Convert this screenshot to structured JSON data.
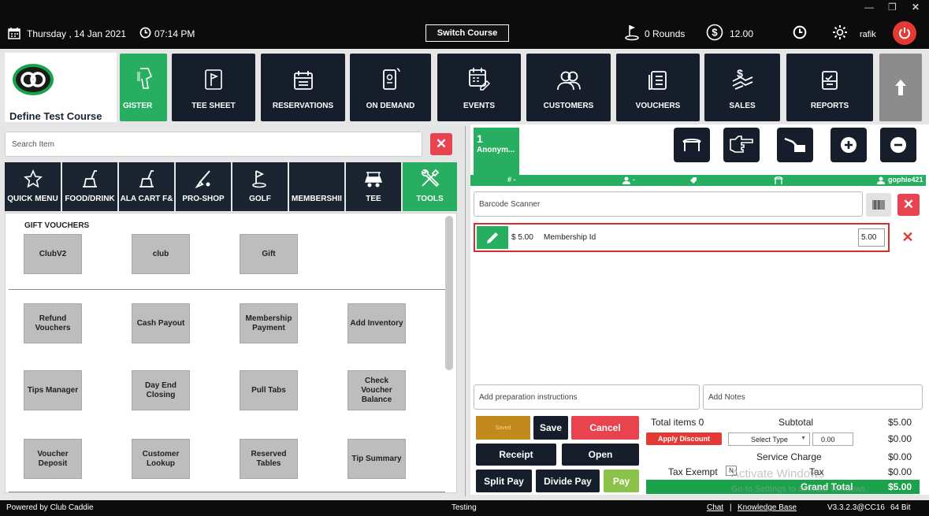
{
  "topbar": {
    "date": "Thursday , 14 Jan 2021",
    "time": "07:14 PM",
    "switch_course": "Switch Course",
    "rounds": "0 Rounds",
    "balance": "12.00",
    "user": "rafik"
  },
  "course": {
    "name": "Define Test Course"
  },
  "nav": [
    {
      "label": "GISTER",
      "icon": "barcode-scanner-icon"
    },
    {
      "label": "TEE SHEET",
      "icon": "flag-icon"
    },
    {
      "label": "RESERVATIONS",
      "icon": "calendar-icon"
    },
    {
      "label": "ON DEMAND",
      "icon": "mobile-icon"
    },
    {
      "label": "EVENTS",
      "icon": "event-calendar-icon"
    },
    {
      "label": "CUSTOMERS",
      "icon": "users-icon"
    },
    {
      "label": "VOUCHERS",
      "icon": "voucher-icon"
    },
    {
      "label": "SALES",
      "icon": "sales-icon"
    },
    {
      "label": "REPORTS",
      "icon": "report-icon"
    }
  ],
  "search": {
    "placeholder": "Search Item"
  },
  "categories": [
    {
      "label": "QUICK MENU"
    },
    {
      "label": "FOOD/DRINK"
    },
    {
      "label": "ALA CART F&"
    },
    {
      "label": "PRO-SHOP"
    },
    {
      "label": "GOLF"
    },
    {
      "label": "MEMBERSHII"
    },
    {
      "label": "TEE"
    },
    {
      "label": "TOOLS"
    }
  ],
  "grid": {
    "section_title": "GIFT VOUCHERS",
    "vouchers": [
      "ClubV2",
      "club",
      "Gift"
    ],
    "tools": [
      "Refund Vouchers",
      "Cash Payout",
      "Membership Payment",
      "Add Inventory",
      "Tips Manager",
      "Day End Closing",
      "Pull Tabs",
      "Check Voucher Balance",
      "Voucher Deposit",
      "Customer Lookup",
      "Reserved Tables",
      "Tip Summary"
    ]
  },
  "ticket": {
    "number": "1",
    "name": "Anonym...",
    "strip": {
      "hash": "# -",
      "person": "-",
      "member": "gophie421"
    },
    "barcode_placeholder": "Barcode Scanner",
    "item": {
      "price": "$ 5.00",
      "name": "Membership Id",
      "qty": "5.00"
    },
    "prep_placeholder": "Add preparation instructions",
    "notes_placeholder": "Add Notes"
  },
  "actions": {
    "save": "Save",
    "cancel": "Cancel",
    "receipt": "Receipt",
    "open": "Open",
    "split_pay": "Split Pay",
    "divide_pay": "Divide Pay",
    "pay": "Pay",
    "saved": "Saved"
  },
  "summary": {
    "total_items": "Total items  0",
    "apply_discount": "Apply Discount",
    "select_type": "Select Type",
    "discount_value": "0.00",
    "subtotal_label": "Subtotal",
    "subtotal": "$5.00",
    "discount_amount": "$0.00",
    "service_label": "Service Charge",
    "service": "$0.00",
    "tax_exempt": "Tax Exempt",
    "tax_flag": "N",
    "tax_label": "Tax",
    "tax": "$0.00",
    "grand_label": "Grand Total",
    "grand": "$5.00"
  },
  "footer": {
    "powered": "Powered by Club Caddie",
    "env": "Testing",
    "chat": "Chat",
    "sep": "|",
    "kb": "Knowledge Base",
    "version": "V3.3.2.3@CC16",
    "bits": "64 Bit"
  },
  "watermark": {
    "line1": "Activate Windows",
    "line2": "Go to Settings to activate Windows."
  }
}
